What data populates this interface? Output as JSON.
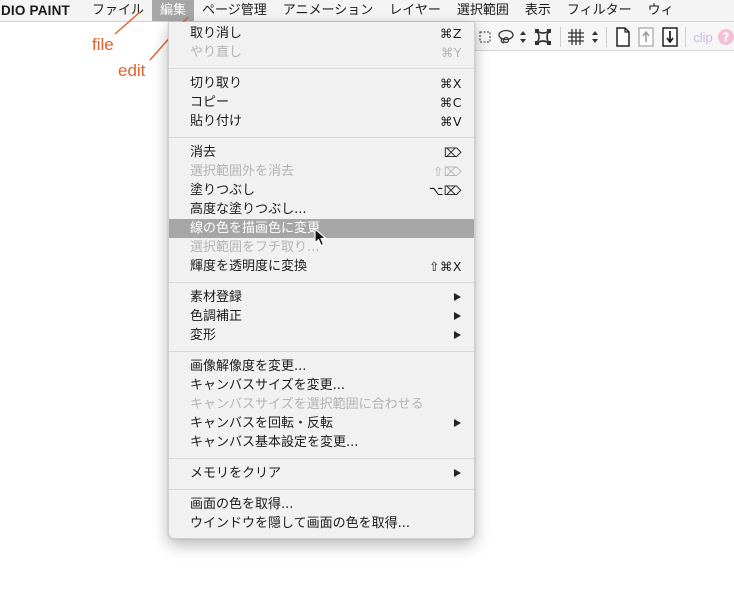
{
  "menubar": {
    "app_name": "UDIO PAINT",
    "items": [
      {
        "label": "ファイル"
      },
      {
        "label": "編集"
      },
      {
        "label": "ページ管理"
      },
      {
        "label": "アニメーション"
      },
      {
        "label": "レイヤー"
      },
      {
        "label": "選択範囲"
      },
      {
        "label": "表示"
      },
      {
        "label": "フィルター"
      },
      {
        "label": "ウィ"
      }
    ],
    "active_index": 1
  },
  "toolbar": {
    "clip_label": "clip",
    "icons": [
      "selection-icon",
      "lasso-icon",
      "updown-icon",
      "transform-icon",
      "grid-icon",
      "updown-icon",
      "new-page-icon",
      "export-icon",
      "import-icon",
      "clip-icon",
      "help-icon"
    ]
  },
  "annotations": {
    "file": "file",
    "edit": "edit",
    "color": "#e5602e"
  },
  "edit_menu": {
    "items": [
      {
        "type": "item",
        "label": "取り消し",
        "shortcut": "⌘Z",
        "disabled": false
      },
      {
        "type": "item",
        "label": "やり直し",
        "shortcut": "⌘Y",
        "disabled": true
      },
      {
        "type": "separator"
      },
      {
        "type": "item",
        "label": "切り取り",
        "shortcut": "⌘X",
        "disabled": false
      },
      {
        "type": "item",
        "label": "コピー",
        "shortcut": "⌘C",
        "disabled": false
      },
      {
        "type": "item",
        "label": "貼り付け",
        "shortcut": "⌘V",
        "disabled": false
      },
      {
        "type": "separator"
      },
      {
        "type": "item",
        "label": "消去",
        "shortcut": "⌦",
        "disabled": false
      },
      {
        "type": "item",
        "label": "選択範囲外を消去",
        "shortcut": "⇧⌦",
        "disabled": true
      },
      {
        "type": "item",
        "label": "塗りつぶし",
        "shortcut": "⌥⌦",
        "disabled": false
      },
      {
        "type": "item",
        "label": "高度な塗りつぶし...",
        "shortcut": "",
        "disabled": false
      },
      {
        "type": "item",
        "label": "線の色を描画色に変更",
        "shortcut": "",
        "disabled": false,
        "highlighted": true
      },
      {
        "type": "item",
        "label": "選択範囲をフチ取り...",
        "shortcut": "",
        "disabled": true
      },
      {
        "type": "item",
        "label": "輝度を透明度に変換",
        "shortcut": "⇧⌘X",
        "disabled": false
      },
      {
        "type": "separator"
      },
      {
        "type": "item",
        "label": "素材登録",
        "submenu": true,
        "disabled": false
      },
      {
        "type": "item",
        "label": "色調補正",
        "submenu": true,
        "disabled": false
      },
      {
        "type": "item",
        "label": "変形",
        "submenu": true,
        "disabled": false
      },
      {
        "type": "separator"
      },
      {
        "type": "item",
        "label": "画像解像度を変更...",
        "shortcut": "",
        "disabled": false
      },
      {
        "type": "item",
        "label": "キャンバスサイズを変更...",
        "shortcut": "",
        "disabled": false
      },
      {
        "type": "item",
        "label": "キャンバスサイズを選択範囲に合わせる",
        "shortcut": "",
        "disabled": true
      },
      {
        "type": "item",
        "label": "キャンバスを回転・反転",
        "submenu": true,
        "disabled": false
      },
      {
        "type": "item",
        "label": "キャンバス基本設定を変更...",
        "shortcut": "",
        "disabled": false
      },
      {
        "type": "separator"
      },
      {
        "type": "item",
        "label": "メモリをクリア",
        "submenu": true,
        "disabled": false
      },
      {
        "type": "separator"
      },
      {
        "type": "item",
        "label": "画面の色を取得...",
        "shortcut": "",
        "disabled": false
      },
      {
        "type": "item",
        "label": "ウインドウを隠して画面の色を取得...",
        "shortcut": "",
        "disabled": false
      }
    ]
  }
}
